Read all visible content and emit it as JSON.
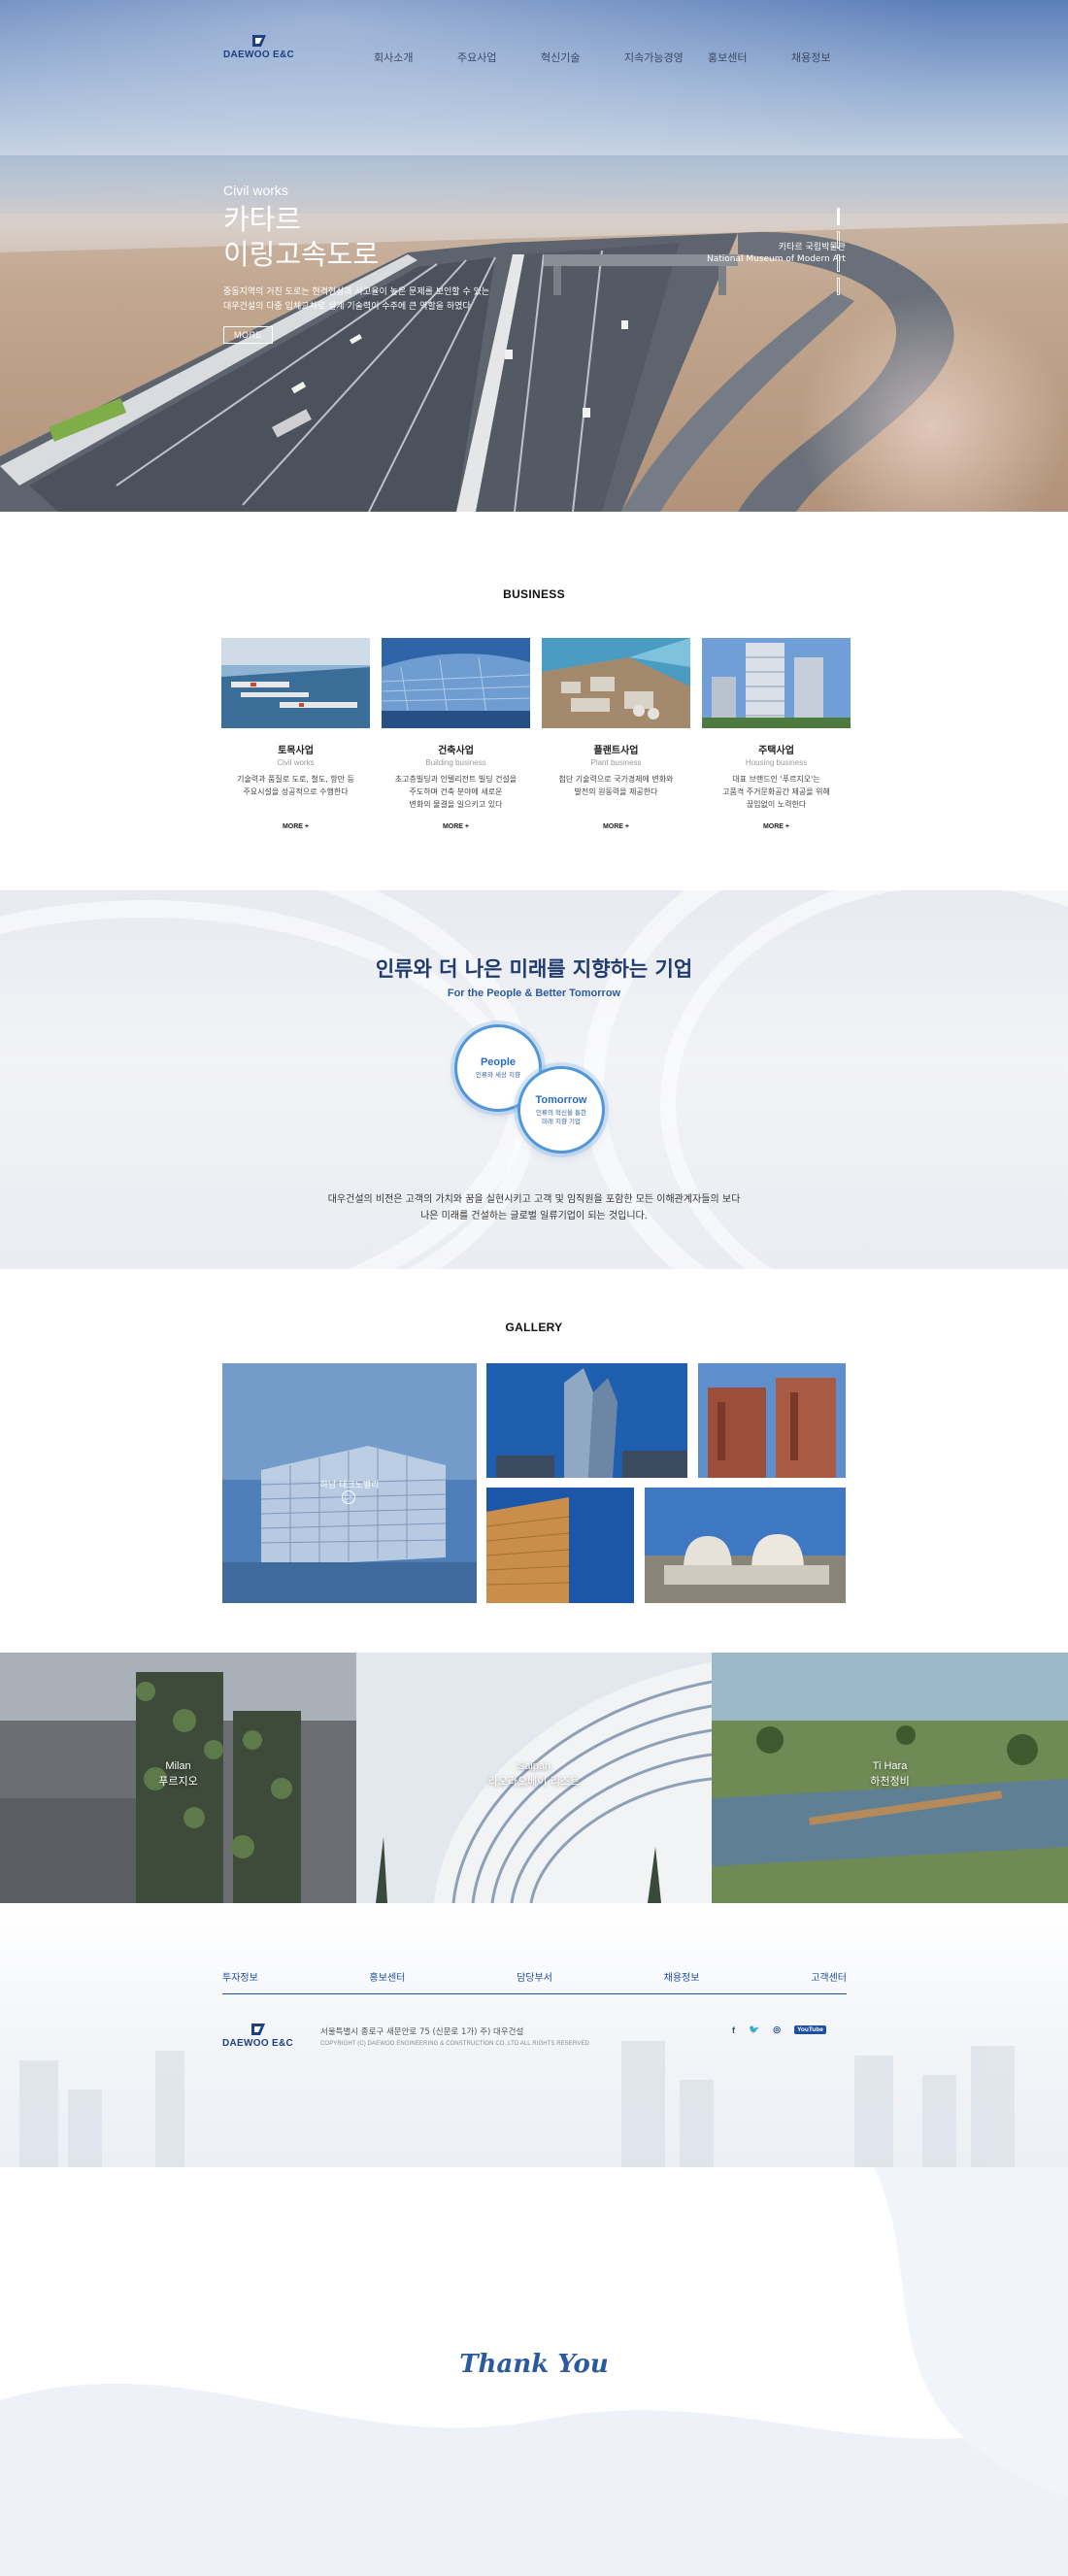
{
  "brand": {
    "logo_text": "DAEWOO E&C",
    "primary_color": "#1d3f83",
    "accent_color": "#2a6cc0"
  },
  "nav": {
    "items": [
      "회사소개",
      "주요사업",
      "혁신기술",
      "지속가능경영",
      "홍보센터",
      "채용정보"
    ]
  },
  "hero": {
    "subtitle": "Civil works",
    "title_line1": "카타르",
    "title_line2": "이링고속도로",
    "desc_line1": "중동지역의 거친 도로는 현격현상과 사고율이 높은 문제를 보인할 수 있는",
    "desc_line2": "대우건설의 다중 입체교차로 설계 기술력이 수주에 큰 역할을 하였다",
    "more_label": "MORE",
    "caption_line1": "카타르 국립박물관",
    "caption_line2": "National Museum of Modern Art",
    "slide_count": 4,
    "active_slide": 1
  },
  "business": {
    "title": "BUSINESS",
    "cards": [
      {
        "name": "토목사업",
        "en": "Civil works",
        "desc_line1": "기술력과 품질로 도로, 철도, 항만 등",
        "desc_line2": "주요시설을 성공적으로 수행한다",
        "desc_line3": "",
        "more": "MORE +"
      },
      {
        "name": "건축사업",
        "en": "Building business",
        "desc_line1": "초고층빌딩과 인텔리전트 빌딩 건설을",
        "desc_line2": "주도하며 건축 분야에 새로운",
        "desc_line3": "변화의 물결을 일으키고 있다",
        "more": "MORE +"
      },
      {
        "name": "플랜트사업",
        "en": "Plant business",
        "desc_line1": "첨단 기술력으로 국가경제에 변화와",
        "desc_line2": "발전의 원동력을 제공한다",
        "desc_line3": "",
        "more": "MORE +"
      },
      {
        "name": "주택사업",
        "en": "Housing business",
        "desc_line1": "대표 브랜드인 '푸르지오'는",
        "desc_line2": "고품격 주거문화공간 제공을 위해",
        "desc_line3": "끊임없이 노력한다",
        "more": "MORE +"
      }
    ]
  },
  "vision": {
    "title": "인류와 더 나은 미래를 지향하는 기업",
    "subtitle": "For the People & Better Tomorrow",
    "circle1_en": "People",
    "circle1_ko": "인류와 세상 지향",
    "circle2_en": "Tomorrow",
    "circle2_ko_line1": "인류의 혁신을 통한",
    "circle2_ko_line2": "미래 지향 기업",
    "text_line1": "대우건설의 비전은 고객의 가치와 꿈을 실현시키고 고객 및 임직원을 포함한 모든 이해관계자들의 보다",
    "text_line2": "나은 미래를 건설하는 글로벌 일류기업이 되는 것입니다."
  },
  "gallery": {
    "title": "GALLERY",
    "main_label": "하남 테크노밸리",
    "play_icon": "▷"
  },
  "strip": [
    {
      "city": "Milan",
      "name": "푸르지오"
    },
    {
      "city": "Saipan",
      "name": "라오라오베이 리조트"
    },
    {
      "city": "Ti Hara",
      "name": "하천정비"
    }
  ],
  "footer": {
    "links": [
      "투자정보",
      "홍보센터",
      "담당부서",
      "채용정보",
      "고객센터"
    ],
    "address": "서울특별시 종로구 새문안로 75 (신문로 1가) 주) 대우건설",
    "copyright": "COPYRIGHT (C) DAEWOO ENGINEERING & CONSTRUCTION CO.,LTD ALL RIGHTS RESERVED",
    "social": {
      "facebook": "f",
      "twitter": "🐦",
      "instagram": "◎",
      "youtube": "YouTube"
    }
  },
  "thanks": {
    "text": "Thank You"
  }
}
